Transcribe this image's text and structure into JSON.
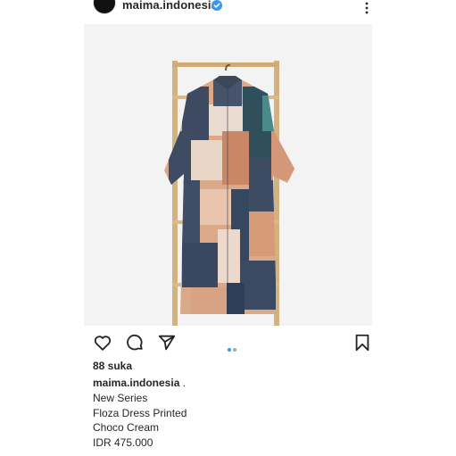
{
  "header": {
    "username": "maima.indonesia",
    "verified_color": "#3897f0",
    "more_icon": "more-vertical-icon"
  },
  "post": {
    "image_alt_subject": "printed shirt dress on wooden ladder",
    "carousel": {
      "current": 1,
      "total": 2,
      "active_color": "#3897f0",
      "inactive_color": "#a8a8a8"
    },
    "likes": "88 suka",
    "caption": {
      "username": "maima.indonesia",
      "suffix": " .",
      "lines": [
        "New Series",
        "Floza Dress Printed",
        "Choco Cream",
        "IDR 475.000"
      ]
    }
  },
  "actions": {
    "like_icon": "heart-icon",
    "comment_icon": "comment-icon",
    "share_icon": "send-icon",
    "save_icon": "bookmark-icon"
  }
}
